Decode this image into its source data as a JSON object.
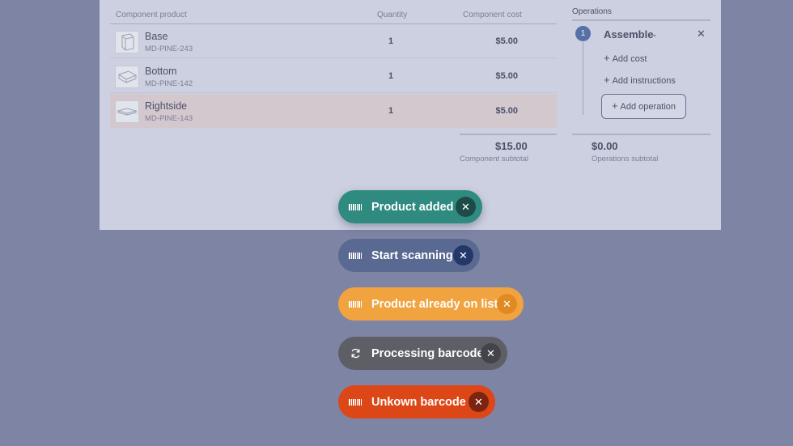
{
  "table": {
    "headers": {
      "product": "Component product",
      "quantity": "Quantity",
      "cost": "Component cost"
    },
    "rows": [
      {
        "name": "Base",
        "sku": "MD-PINE-243",
        "quantity": "1",
        "cost": "$5.00"
      },
      {
        "name": "Bottom",
        "sku": "MD-PINE-142",
        "quantity": "1",
        "cost": "$5.00"
      },
      {
        "name": "Rightside",
        "sku": "MD-PINE-143",
        "quantity": "1",
        "cost": "$5.00"
      }
    ],
    "subtotal": {
      "value": "$15.00",
      "label": "Component subtotal"
    }
  },
  "operations": {
    "header": "Operations",
    "items": [
      {
        "number": "1",
        "title": "Assemble",
        "add_cost": "Add cost",
        "add_instructions": "Add instructions"
      }
    ],
    "add_operation": "Add operation",
    "subtotal": {
      "value": "$0.00",
      "label": "Operations subtotal"
    }
  },
  "toasts": [
    {
      "label": "Product added",
      "icon": "barcode-icon",
      "color": "#2f8a80"
    },
    {
      "label": "Start scanning",
      "icon": "barcode-icon",
      "color": "#5a6991"
    },
    {
      "label": "Product already on list",
      "icon": "barcode-icon",
      "color": "#f0a33f"
    },
    {
      "label": "Processing barcode",
      "icon": "refresh-icon",
      "color": "#5e5f66"
    },
    {
      "label": "Unkown barcode",
      "icon": "barcode-icon",
      "color": "#dd4616"
    }
  ],
  "colors": {
    "backdrop": "#7e84a3",
    "panel": "#cdd0e0",
    "row_highlight": "#d4c8cf",
    "accent": "#5771a8"
  }
}
